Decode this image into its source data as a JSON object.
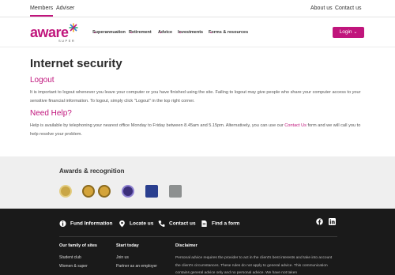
{
  "topbar": {
    "members": "Members",
    "adviser": "Adviser",
    "about": "About us",
    "contact": "Contact us"
  },
  "logo": {
    "word": "aware",
    "super": "SUPER"
  },
  "nav": {
    "items": [
      "Superannuation",
      "Retirement",
      "Advice",
      "Investments",
      "Forms & resources"
    ],
    "login": "Login"
  },
  "content": {
    "title": "Internet security",
    "logout_heading": "Logout",
    "logout_text": "It is important to logout whenever you leave your computer or you have finished using the site. Failing to logout may give people who share your computer access to your sensitive financial information. To logout, simply click \"Logout\" in the top right corner.",
    "help_heading": "Need Help?",
    "help_text_before": "Help is available by telephoning your nearest office Monday to Friday between 8.45am and 5.15pm. Alternatively, you can use our ",
    "help_link": "Contact Us",
    "help_text_after": " form and we will call you to help resolve your problem."
  },
  "awards": {
    "title": "Awards & recognition"
  },
  "footer": {
    "quick_links": [
      "Fund Information",
      "Locate us",
      "Contact us",
      "Find a form"
    ],
    "col1_head": "Our family of sites",
    "col1_items": [
      "Student club",
      "Women & super"
    ],
    "col2_head": "Start today",
    "col2_items": [
      "Join us",
      "Partner as an employer"
    ],
    "disclaimer_head": "Disclaimer",
    "disclaimer_text": "Personal advice requires the provider to act in the client's best interests and take into account the client's circumstances. These rules do not apply to general advice. This communication contains general advice only and no personal advice. We have not taken"
  },
  "colors": {
    "brand": "#c0157c",
    "footer_bg": "#1a1a1a",
    "awards_bg": "#efefef"
  }
}
